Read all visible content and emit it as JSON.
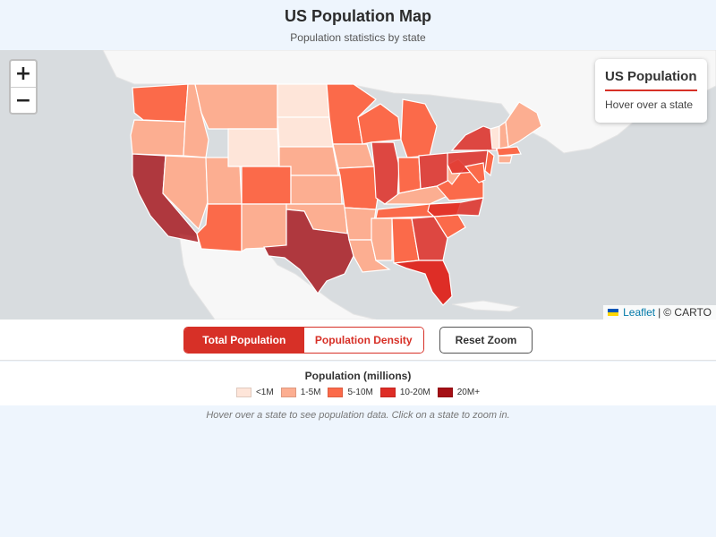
{
  "header": {
    "title": "US Population Map",
    "subtitle": "Population statistics by state"
  },
  "zoom": {
    "in_label": "+",
    "out_label": "−"
  },
  "info": {
    "title": "US Population",
    "text": "Hover over a state"
  },
  "attribution": {
    "link": "Leaflet",
    "separator": "|",
    "provider": "© CARTO"
  },
  "controls": {
    "mode_total": "Total Population",
    "mode_density": "Population Density",
    "active_mode": "Total Population",
    "reset": "Reset Zoom"
  },
  "legend": {
    "title": "Population (millions)",
    "items": [
      {
        "label": "<1M",
        "color": "#fee5d9"
      },
      {
        "label": "1-5M",
        "color": "#fcae91"
      },
      {
        "label": "5-10M",
        "color": "#fb6a4a"
      },
      {
        "label": "10-20M",
        "color": "#de2d26"
      },
      {
        "label": "20M+",
        "color": "#a50f15"
      }
    ]
  },
  "footer": "Hover over a state to see population data. Click on a state to zoom in.",
  "colors": {
    "accent": "#d73027",
    "water": "#d8dcdf",
    "land": "#f7f7f7",
    "border": "#ffffff"
  }
}
